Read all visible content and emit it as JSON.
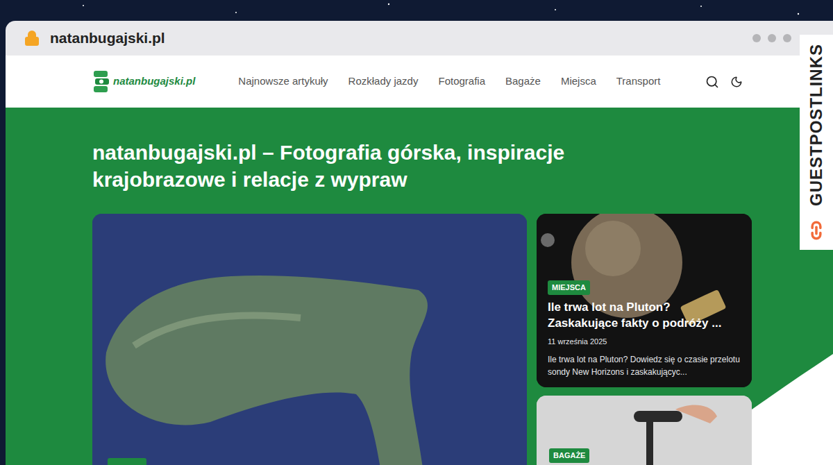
{
  "browser": {
    "url": "natanbugajski.pl"
  },
  "site": {
    "logo": "natanbugajski.pl",
    "nav": [
      "Najnowsze artykuły",
      "Rozkłady jazdy",
      "Fotografia",
      "Bagaże",
      "Miejsca",
      "Transport"
    ]
  },
  "hero": {
    "heading": "natanbugajski.pl – Fotografia górska, inspiracje krajobrazowe i relacje z wypraw"
  },
  "cards": [
    {
      "tag": "MIEJSCA",
      "title": "Ile trwa lot na Pluton? Zaskakujące fakty o podróży ...",
      "date": "11 września 2025",
      "excerpt": "Ile trwa lot na Pluton? Dowiedz się o czasie przelotu sondy New Horizons i zaskakującyc..."
    },
    {
      "tag": "BAGAŻE"
    }
  ],
  "watermark": "GUESTPOSTLINKS"
}
